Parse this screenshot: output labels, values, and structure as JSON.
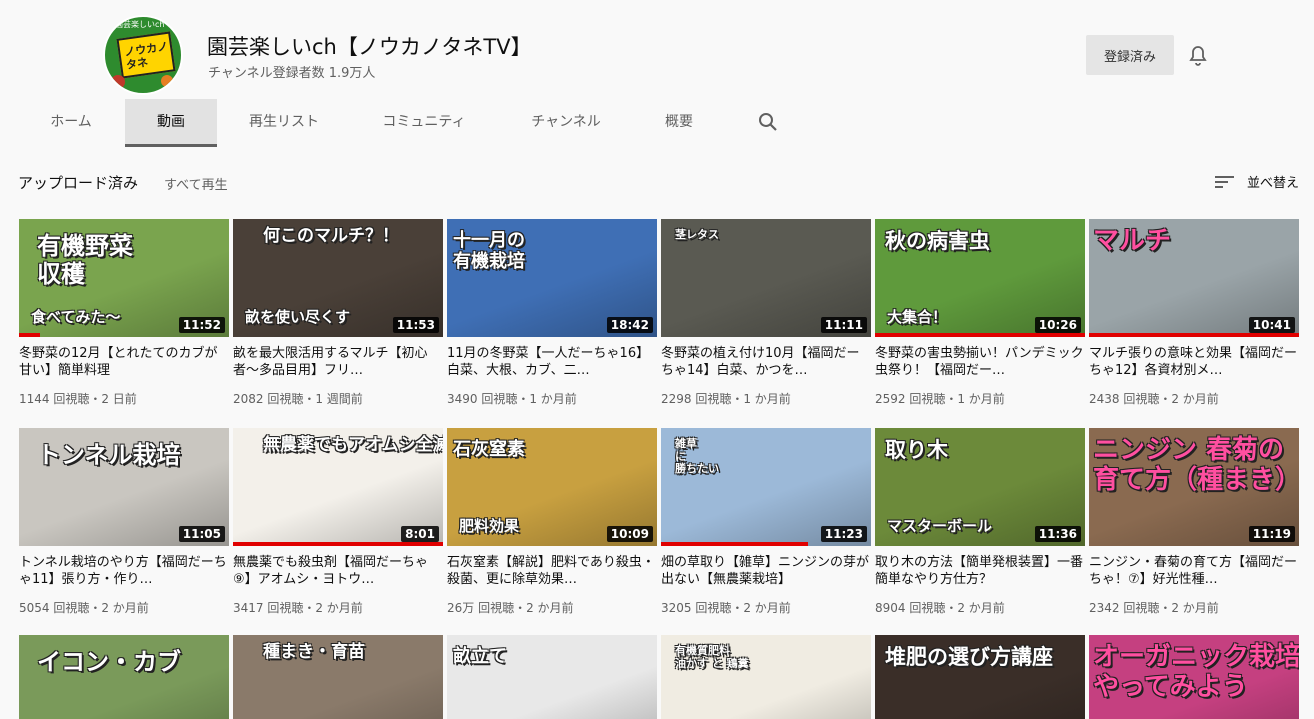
{
  "channel": {
    "name": "園芸楽しいch【ノウカノタネTV】",
    "subscribers": "チャンネル登録者数 1.9万人",
    "avatar_sign": "ノウカノ\nタネ",
    "avatar_ring": "園芸楽しいch",
    "subscribe_label": "登録済み"
  },
  "tabs": [
    "ホーム",
    "動画",
    "再生リスト",
    "コミュニティ",
    "チャンネル",
    "概要"
  ],
  "active_tab": "動画",
  "section": {
    "title": "アップロード済み",
    "play_all": "すべて再生",
    "sort_label": "並べ替え"
  },
  "videos": [
    {
      "title": "冬野菜の12月【とれたてのカブが甘い】簡単料理",
      "meta": "1144 回視聴・2 日前",
      "duration": "11:52",
      "caption": "有機野菜\n収穫",
      "caption2": "食べてみた〜",
      "bg": "#7aa44e",
      "progress": 0.1
    },
    {
      "title": "畝を最大限活用するマルチ【初心者〜多品目用】フリ…",
      "meta": "2082 回視聴・1 週間前",
      "duration": "11:53",
      "caption": "何このマルチ？！",
      "caption2": "畝を使い尽くす",
      "bg": "#4a4038",
      "progress": 0
    },
    {
      "title": "11月の冬野菜【一人だーちゃ16】白菜、大根、カブ、二…",
      "meta": "3490 回視聴・1 か月前",
      "duration": "18:42",
      "caption": "十一月の\n有機栽培",
      "caption2": "",
      "bg": "#3f6fb5",
      "progress": 0
    },
    {
      "title": "冬野菜の植え付け10月【福岡だーちゃ14】白菜、かつを…",
      "meta": "2298 回視聴・1 か月前",
      "duration": "11:11",
      "caption": "茎レタス",
      "caption2": "",
      "bg": "#5a5a52",
      "progress": 0
    },
    {
      "title": "冬野菜の害虫勢揃い！パンデミック虫祭り！【福岡だー…",
      "meta": "2592 回視聴・1 か月前",
      "duration": "10:26",
      "caption": "秋の病害虫",
      "caption2": "大集合！",
      "bg": "#5f9a3c",
      "progress": 1.0
    },
    {
      "title": "マルチ張りの意味と効果【福岡だーちゃ12】各資材別メ…",
      "meta": "2438 回視聴・2 か月前",
      "duration": "10:41",
      "caption": "マルチ",
      "caption2": "",
      "bg": "#9aa4a8",
      "progress": 1.0
    },
    {
      "title": "トンネル栽培のやり方【福岡だーちゃ11】張り方・作り…",
      "meta": "5054 回視聴・2 か月前",
      "duration": "11:05",
      "caption": "トンネル栽培",
      "caption2": "",
      "bg": "#c9c6c0",
      "progress": 0
    },
    {
      "title": "無農薬でも殺虫剤【福岡だーちゃ⑨】アオムシ・ヨトウ…",
      "meta": "3417 回視聴・2 か月前",
      "duration": "8:01",
      "caption": "無農薬でもアオムシ全滅",
      "caption2": "",
      "bg": "#f3f0ea",
      "progress": 1.0
    },
    {
      "title": "石灰窒素【解説】肥料であり殺虫・殺菌、更に除草効果…",
      "meta": "26万 回視聴・2 か月前",
      "duration": "10:09",
      "caption": "石灰窒素",
      "caption2": "肥料効果",
      "bg": "#c8a040",
      "progress": 0
    },
    {
      "title": "畑の草取り【雑草】ニンジンの芽が出ない【無農薬栽培】",
      "meta": "3205 回視聴・2 か月前",
      "duration": "11:23",
      "caption": "雑草\nに\n勝ちたい",
      "caption2": "",
      "bg": "#9cb9d8",
      "progress": 0.7
    },
    {
      "title": "取り木の方法【簡単発根装置】一番簡単なやり方仕方？",
      "meta": "8904 回視聴・2 か月前",
      "duration": "11:36",
      "caption": "取り木",
      "caption2": "マスターボール",
      "bg": "#6c8a3a",
      "progress": 0
    },
    {
      "title": "ニンジン・春菊の育て方【福岡だーちゃ！⑦】好光性種…",
      "meta": "2342 回視聴・2 か月前",
      "duration": "11:19",
      "caption": "ニンジン 春菊の\n育て方（種まき）",
      "caption2": "",
      "bg": "#8a6a50",
      "progress": 0
    },
    {
      "title": "",
      "meta": "",
      "duration": "",
      "caption": "イコン・カブ",
      "caption2": "",
      "bg": "#7a9a5a",
      "progress": 0
    },
    {
      "title": "",
      "meta": "",
      "duration": "",
      "caption": "種まき・育苗",
      "caption2": "",
      "bg": "#8a7a6a",
      "progress": 0
    },
    {
      "title": "",
      "meta": "",
      "duration": "",
      "caption": "畝立て",
      "caption2": "",
      "bg": "#e8e8e8",
      "progress": 0
    },
    {
      "title": "",
      "meta": "",
      "duration": "",
      "caption": "有機質肥料\n油かす と 鶏糞",
      "caption2": "",
      "bg": "#f0ece2",
      "progress": 0
    },
    {
      "title": "",
      "meta": "",
      "duration": "",
      "caption": "堆肥の選び方講座",
      "caption2": "",
      "bg": "#3a2e28",
      "progress": 0
    },
    {
      "title": "",
      "meta": "",
      "duration": "",
      "caption": "オーガニック栽培\nやってみよう",
      "caption2": "",
      "bg": "#c54080",
      "progress": 0
    }
  ],
  "colors": {
    "accent": "#e00000",
    "text_primary": "#0f0f0f",
    "text_secondary": "#606060"
  }
}
